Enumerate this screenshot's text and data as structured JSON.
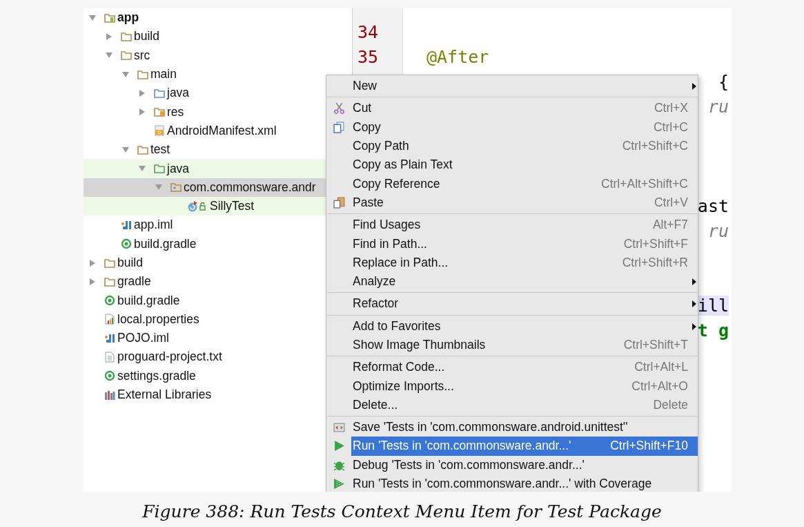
{
  "project_tree": [
    {
      "label": "app",
      "kind": "module",
      "bold": true,
      "expanded": true,
      "selected": false,
      "tinted": false,
      "children": [
        {
          "label": "build",
          "kind": "folder",
          "expanded": false,
          "selected": false,
          "tinted": false
        },
        {
          "label": "src",
          "kind": "folder",
          "expanded": true,
          "selected": false,
          "tinted": false,
          "children": [
            {
              "label": "main",
              "kind": "folder",
              "expanded": true,
              "selected": false,
              "tinted": false,
              "children": [
                {
                  "label": "java",
                  "kind": "source-folder",
                  "expanded": false,
                  "selected": false,
                  "tinted": false
                },
                {
                  "label": "res",
                  "kind": "resource-folder",
                  "expanded": false,
                  "selected": false,
                  "tinted": false
                },
                {
                  "label": "AndroidManifest.xml",
                  "kind": "manifest",
                  "selected": false,
                  "tinted": false
                }
              ]
            },
            {
              "label": "test",
              "kind": "folder",
              "expanded": true,
              "selected": false,
              "tinted": false,
              "children": [
                {
                  "label": "java",
                  "kind": "test-folder",
                  "expanded": true,
                  "selected": false,
                  "tinted": true,
                  "children": [
                    {
                      "label": "com.commonsware.andr",
                      "kind": "package",
                      "expanded": true,
                      "selected": true,
                      "tinted": false,
                      "children": [
                        {
                          "label": "SillyTest",
                          "kind": "test-class",
                          "selected": false,
                          "tinted": true
                        }
                      ]
                    }
                  ]
                }
              ]
            }
          ]
        },
        {
          "label": "app.iml",
          "kind": "iml",
          "selected": false,
          "tinted": false
        },
        {
          "label": "build.gradle",
          "kind": "gradle",
          "selected": false,
          "tinted": false
        }
      ]
    },
    {
      "label": "build",
      "kind": "folder",
      "expanded": false,
      "selected": false,
      "tinted": false
    },
    {
      "label": "gradle",
      "kind": "folder",
      "expanded": false,
      "selected": false,
      "tinted": false
    },
    {
      "label": "build.gradle",
      "kind": "gradle",
      "selected": false,
      "tinted": false
    },
    {
      "label": "local.properties",
      "kind": "properties",
      "selected": false,
      "tinted": false
    },
    {
      "label": "POJO.iml",
      "kind": "iml",
      "selected": false,
      "tinted": false
    },
    {
      "label": "proguard-project.txt",
      "kind": "text",
      "selected": false,
      "tinted": false
    },
    {
      "label": "settings.gradle",
      "kind": "gradle",
      "selected": false,
      "tinted": false
    },
    {
      "label": "External Libraries",
      "kind": "libraries",
      "selected": false,
      "tinted": false
    }
  ],
  "editor": {
    "lines": [
      {
        "number": "34",
        "kind": "plain"
      },
      {
        "number": "35",
        "code": "@After",
        "kind": "annotation"
      },
      {
        "code": "{",
        "kind": "fragment"
      },
      {
        "code": "ru",
        "kind": "fragment-comment"
      },
      {
        "kind": "blank"
      },
      {
        "kind": "blank"
      },
      {
        "kind": "blank"
      },
      {
        "code": "ast",
        "kind": "fragment"
      },
      {
        "code": "ru",
        "kind": "fragment-comment"
      },
      {
        "kind": "blank"
      },
      {
        "kind": "blank"
      },
      {
        "code": "ill",
        "kind": "fragment-highlight"
      },
      {
        "code": "t g",
        "kind": "fragment-string"
      }
    ]
  },
  "context_menu": {
    "groups": [
      {
        "items": [
          {
            "label": "New",
            "submenu": true,
            "selected": false
          }
        ]
      },
      {
        "items": [
          {
            "label": "Cut",
            "kind": "cut",
            "shortcut": "Ctrl+X",
            "submenu": false,
            "selected": false
          },
          {
            "label": "Copy",
            "kind": "copy",
            "shortcut": "Ctrl+C",
            "submenu": false,
            "selected": false
          },
          {
            "label": "Copy Path",
            "shortcut": "Ctrl+Shift+C",
            "submenu": false,
            "selected": false
          },
          {
            "label": "Copy as Plain Text",
            "submenu": false,
            "selected": false
          },
          {
            "label": "Copy Reference",
            "shortcut": "Ctrl+Alt+Shift+C",
            "submenu": false,
            "selected": false
          },
          {
            "label": "Paste",
            "kind": "paste",
            "shortcut": "Ctrl+V",
            "submenu": false,
            "selected": false
          }
        ]
      },
      {
        "items": [
          {
            "label": "Find Usages",
            "shortcut": "Alt+F7",
            "submenu": false,
            "selected": false
          },
          {
            "label": "Find in Path...",
            "shortcut": "Ctrl+Shift+F",
            "submenu": false,
            "selected": false
          },
          {
            "label": "Replace in Path...",
            "shortcut": "Ctrl+Shift+R",
            "submenu": false,
            "selected": false
          },
          {
            "label": "Analyze",
            "submenu": true,
            "selected": false
          }
        ]
      },
      {
        "items": [
          {
            "label": "Refactor",
            "submenu": true,
            "selected": false
          }
        ]
      },
      {
        "items": [
          {
            "label": "Add to Favorites",
            "submenu": true,
            "selected": false
          },
          {
            "label": "Show Image Thumbnails",
            "shortcut": "Ctrl+Shift+T",
            "submenu": false,
            "selected": false
          }
        ]
      },
      {
        "items": [
          {
            "label": "Reformat Code...",
            "shortcut": "Ctrl+Alt+L",
            "submenu": false,
            "selected": false
          },
          {
            "label": "Optimize Imports...",
            "shortcut": "Ctrl+Alt+O",
            "submenu": false,
            "selected": false
          },
          {
            "label": "Delete...",
            "shortcut": "Delete",
            "submenu": false,
            "selected": false
          }
        ]
      },
      {
        "items": [
          {
            "label": "Save 'Tests in 'com.commonsware.android.unittest''",
            "kind": "save-config",
            "submenu": false,
            "selected": false
          },
          {
            "label": "Run 'Tests in 'com.commonsware.andr...'",
            "kind": "run",
            "shortcut": "Ctrl+Shift+F10",
            "submenu": false,
            "selected": true
          },
          {
            "label": "Debug 'Tests in 'com.commonsware.andr...'",
            "kind": "debug",
            "submenu": false,
            "selected": false
          },
          {
            "label": "Run 'Tests in 'com.commonsware.andr...' with Coverage",
            "kind": "coverage",
            "submenu": false,
            "selected": false
          }
        ]
      }
    ]
  },
  "caption": "Figure 388: Run Tests Context Menu Item for Test Package"
}
